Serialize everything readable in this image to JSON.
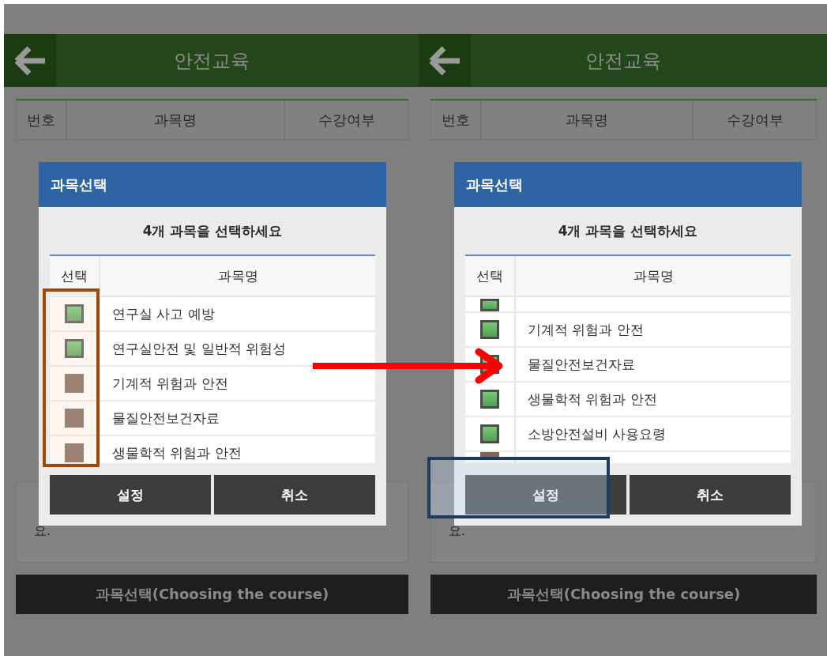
{
  "panels": [
    {
      "header": {
        "title": "안전교육"
      },
      "table_columns": [
        "번호",
        "과목명",
        "수강여부"
      ],
      "notice": {
        "text": "요."
      },
      "course_button": "과목선택(Choosing the course)",
      "dialog": {
        "title": "과목선택",
        "instruction": "4개 과목을 선택하세요",
        "columns": [
          "선택",
          "과목명"
        ],
        "rows": [
          {
            "kind": "full",
            "name": "연구실 사고 예방",
            "checked": true
          },
          {
            "kind": "full",
            "name": "연구실안전 및 일반적 위험성",
            "checked": true
          },
          {
            "kind": "full",
            "name": "기계적 위험과 안전",
            "checked": false
          },
          {
            "kind": "full",
            "name": "물질안전보건자료",
            "checked": false
          },
          {
            "kind": "full",
            "name": "생물학적 위험과 안전",
            "checked": false
          }
        ],
        "buttons": [
          "설정",
          "취소"
        ]
      }
    },
    {
      "header": {
        "title": "안전교육"
      },
      "table_columns": [
        "번호",
        "과목명",
        "수강여부"
      ],
      "notice": {
        "text": "요."
      },
      "course_button": "과목선택(Choosing the course)",
      "dialog": {
        "title": "과목선택",
        "instruction": "4개 과목을 선택하세요",
        "columns": [
          "선택",
          "과목명"
        ],
        "rows": [
          {
            "kind": "partial",
            "checked": true
          },
          {
            "kind": "full",
            "name": "기계적 위험과 안전",
            "checked": true
          },
          {
            "kind": "full",
            "name": "물질안전보건자료",
            "checked": true
          },
          {
            "kind": "full",
            "name": "생물학적 위험과 안전",
            "checked": true
          },
          {
            "kind": "full",
            "name": "소방안전설비 사용요령",
            "checked": true
          },
          {
            "kind": "partial",
            "checked": false
          }
        ],
        "buttons": [
          "설정",
          "취소"
        ]
      }
    }
  ]
}
